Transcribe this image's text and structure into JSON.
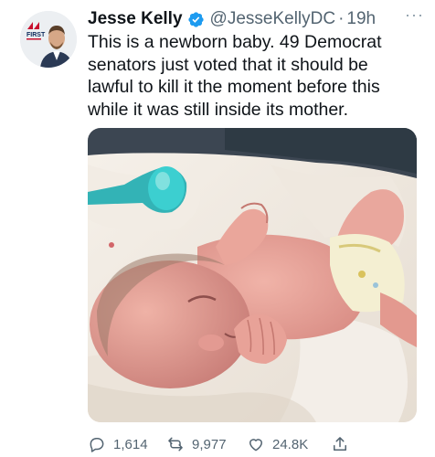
{
  "tweet": {
    "author_name": "Jesse Kelly",
    "handle": "@JesseKellyDC",
    "separator": "·",
    "time": "19h",
    "more": "···",
    "text": "This is a newborn baby. 49 Democrat senators just voted that it should be lawful to kill it the moment before this while it was still inside its mother.",
    "avatar_badge": "FIRST",
    "media_description": "photo-of-newborn-baby",
    "stats": {
      "replies": "1,614",
      "retweets": "9,977",
      "likes": "24.8K"
    }
  },
  "colors": {
    "verified": "#1d9bf0",
    "muted": "#536471",
    "badge_red": "#c8102e",
    "badge_navy": "#0b2a5b"
  }
}
